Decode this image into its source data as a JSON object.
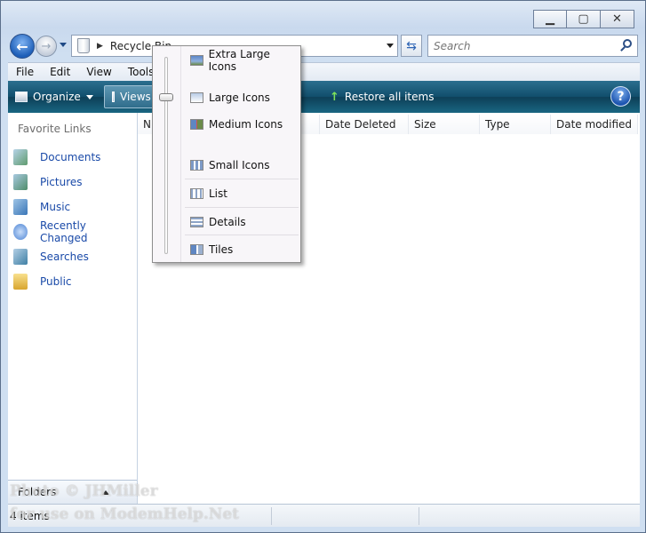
{
  "window": {
    "minimize_glyph": "▁",
    "maximize_glyph": "▢",
    "close_glyph": "✕"
  },
  "address": {
    "crumb": "Recycle Bin",
    "separator": "▶"
  },
  "search": {
    "placeholder": "Search"
  },
  "menubar": {
    "items": [
      "File",
      "Edit",
      "View",
      "Tools"
    ]
  },
  "toolbar": {
    "organize_label": "Organize",
    "views_label": "Views",
    "restore_label": "Restore all items",
    "help_glyph": "?"
  },
  "navpane": {
    "header": "Favorite Links",
    "items": [
      "Documents",
      "Pictures",
      "Music",
      "Recently Changed",
      "Searches",
      "Public"
    ],
    "folders_label": "Folders"
  },
  "columns": [
    "N",
    "Date Deleted",
    "Size",
    "Type",
    "Date modified"
  ],
  "status": {
    "count": "4 items"
  },
  "view_menu": {
    "items": [
      "Extra Large Icons",
      "Large Icons",
      "Medium Icons",
      "Small Icons",
      "List",
      "Details",
      "Tiles"
    ]
  },
  "watermark": {
    "line1": "Photo © JHMiller",
    "line2": "for use on ModemHelp.Net"
  },
  "colors": {
    "toolbar": "#114e6c",
    "link": "#1a4aa8",
    "window_frame": "#c9d9ee"
  }
}
